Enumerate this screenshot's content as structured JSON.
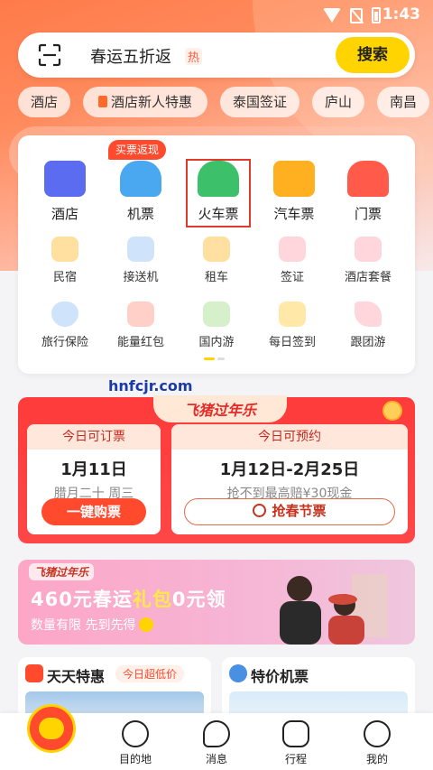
{
  "status_bar": {
    "time": "1:43"
  },
  "search": {
    "query": "春运五折返",
    "hot_tag": "热",
    "button": "搜索"
  },
  "chips": [
    "酒店",
    "酒店新人特惠",
    "泰国签证",
    "庐山",
    "南昌"
  ],
  "services": {
    "refund_tag": "买票返现",
    "main": [
      {
        "label": "酒店",
        "color": "#5b6cf0"
      },
      {
        "label": "机票",
        "color": "#4aa8f0"
      },
      {
        "label": "火车票",
        "color": "#3cc06a"
      },
      {
        "label": "汽车票",
        "color": "#ffb020"
      },
      {
        "label": "门票",
        "color": "#ff5a4a"
      }
    ],
    "row2": [
      {
        "label": "民宿",
        "color": "#ffcc55"
      },
      {
        "label": "接送机",
        "color": "#7ab8f0"
      },
      {
        "label": "租车",
        "color": "#ffcc55"
      },
      {
        "label": "签证",
        "color": "#ff9aa0"
      },
      {
        "label": "酒店套餐",
        "color": "#ff9aa0"
      }
    ],
    "row3": [
      {
        "label": "旅行保险",
        "color": "#6ab0f0"
      },
      {
        "label": "能量红包",
        "color": "#ff8a7a"
      },
      {
        "label": "国内游",
        "color": "#7acb6a"
      },
      {
        "label": "每日签到",
        "color": "#ffcc55"
      },
      {
        "label": "跟团游",
        "color": "#ff9aa0"
      }
    ]
  },
  "watermark": "hnfcjr.com",
  "festival": {
    "title": "飞猪过年乐",
    "bookable": {
      "head": "今日可订票",
      "date": "1月11日",
      "sub": "腊月二十 周三",
      "button": "一键购票"
    },
    "reservable": {
      "head": "今日可预约",
      "date": "1月12日-2月25日",
      "sub": "抢不到最高赔¥30现金",
      "button": "抢春节票"
    }
  },
  "banner": {
    "tag": "飞猪过年乐",
    "main_prefix": "460元春运",
    "main_highlight": "礼包",
    "main_suffix": "0元领",
    "sub": "数量有限 先到先得"
  },
  "deals": {
    "daily": {
      "title": "天天特惠",
      "tag": "今日超低价"
    },
    "flights": {
      "title": "特价机票"
    }
  },
  "tabbar": [
    "目的地",
    "消息",
    "行程",
    "我的"
  ]
}
